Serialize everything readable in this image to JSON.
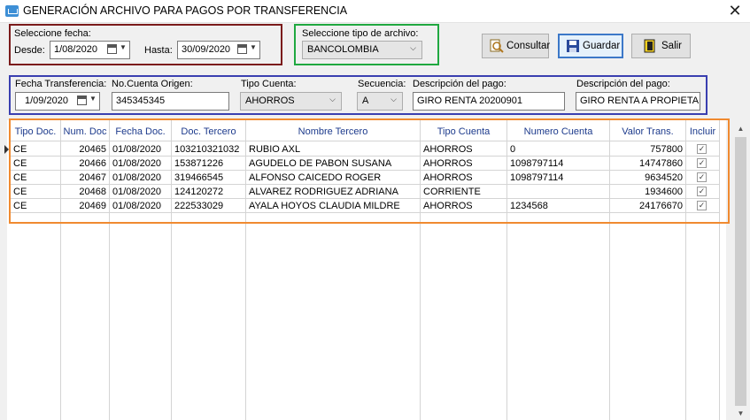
{
  "window": {
    "title": "GENERACIÓN ARCHIVO PARA PAGOS POR TRANSFERENCIA",
    "close_glyph": "✕"
  },
  "fecha_group": {
    "legend": "Seleccione fecha:",
    "desde_label": "Desde:",
    "desde_value": "1/08/2020",
    "hasta_label": "Hasta:",
    "hasta_value": "30/09/2020"
  },
  "tipo_archivo_group": {
    "legend": "Seleccione tipo de archivo:",
    "selected": "BANCOLOMBIA"
  },
  "toolbar": {
    "consultar_label": "Consultar",
    "guardar_label": "Guardar",
    "salir_label": "Salir"
  },
  "transfer_panel": {
    "fecha_label": "Fecha Transferencia:",
    "fecha_value": "1/09/2020",
    "cuenta_label": "No.Cuenta Origen:",
    "cuenta_value": "345345345",
    "tipo_cuenta_label": "Tipo Cuenta:",
    "tipo_cuenta_value": "AHORROS",
    "secuencia_label": "Secuencia:",
    "secuencia_value": "A",
    "descripcion1_label": "Descripción del pago:",
    "descripcion1_value": "GIRO RENTA 20200901",
    "descripcion2_label": "Descripción del pago:",
    "descripcion2_value": "GIRO RENTA A PROPIETARI"
  },
  "grid": {
    "headers": [
      "Tipo Doc.",
      "Num. Doc",
      "Fecha Doc.",
      "Doc. Tercero",
      "Nombre Tercero",
      "Tipo Cuenta",
      "Numero Cuenta",
      "Valor Trans.",
      "Incluir"
    ],
    "rows": [
      {
        "tipo": "CE",
        "num": "20465",
        "fecha": "01/08/2020",
        "doc": "103210321032",
        "nombre": "RUBIO  AXL",
        "tipo_cuenta": "AHORROS",
        "numero_cuenta": "0",
        "valor": "757800",
        "incluir": "✓"
      },
      {
        "tipo": "CE",
        "num": "20466",
        "fecha": "01/08/2020",
        "doc": "153871226",
        "nombre": "AGUDELO DE PABON SUSANA",
        "tipo_cuenta": "AHORROS",
        "numero_cuenta": "1098797114",
        "valor": "14747860",
        "incluir": "✓"
      },
      {
        "tipo": "CE",
        "num": "20467",
        "fecha": "01/08/2020",
        "doc": "319466545",
        "nombre": "ALFONSO CAICEDO ROGER",
        "tipo_cuenta": "AHORROS",
        "numero_cuenta": "1098797114",
        "valor": "9634520",
        "incluir": "✓"
      },
      {
        "tipo": "CE",
        "num": "20468",
        "fecha": "01/08/2020",
        "doc": "124120272",
        "nombre": "ALVAREZ RODRIGUEZ ADRIANA",
        "tipo_cuenta": "CORRIENTE",
        "numero_cuenta": "",
        "valor": "1934600",
        "incluir": "✓"
      },
      {
        "tipo": "CE",
        "num": "20469",
        "fecha": "01/08/2020",
        "doc": "222533029",
        "nombre": "AYALA HOYOS CLAUDIA MILDRE",
        "tipo_cuenta": "AHORROS",
        "numero_cuenta": "1234568",
        "valor": "24176670",
        "incluir": "✓"
      }
    ]
  },
  "colors": {
    "fecha_border": "#7b1b1b",
    "archivo_border": "#20a840",
    "transfer_border": "#3a3fb0",
    "grid_border": "#f08a30",
    "header_text": "#1c3a8c"
  }
}
